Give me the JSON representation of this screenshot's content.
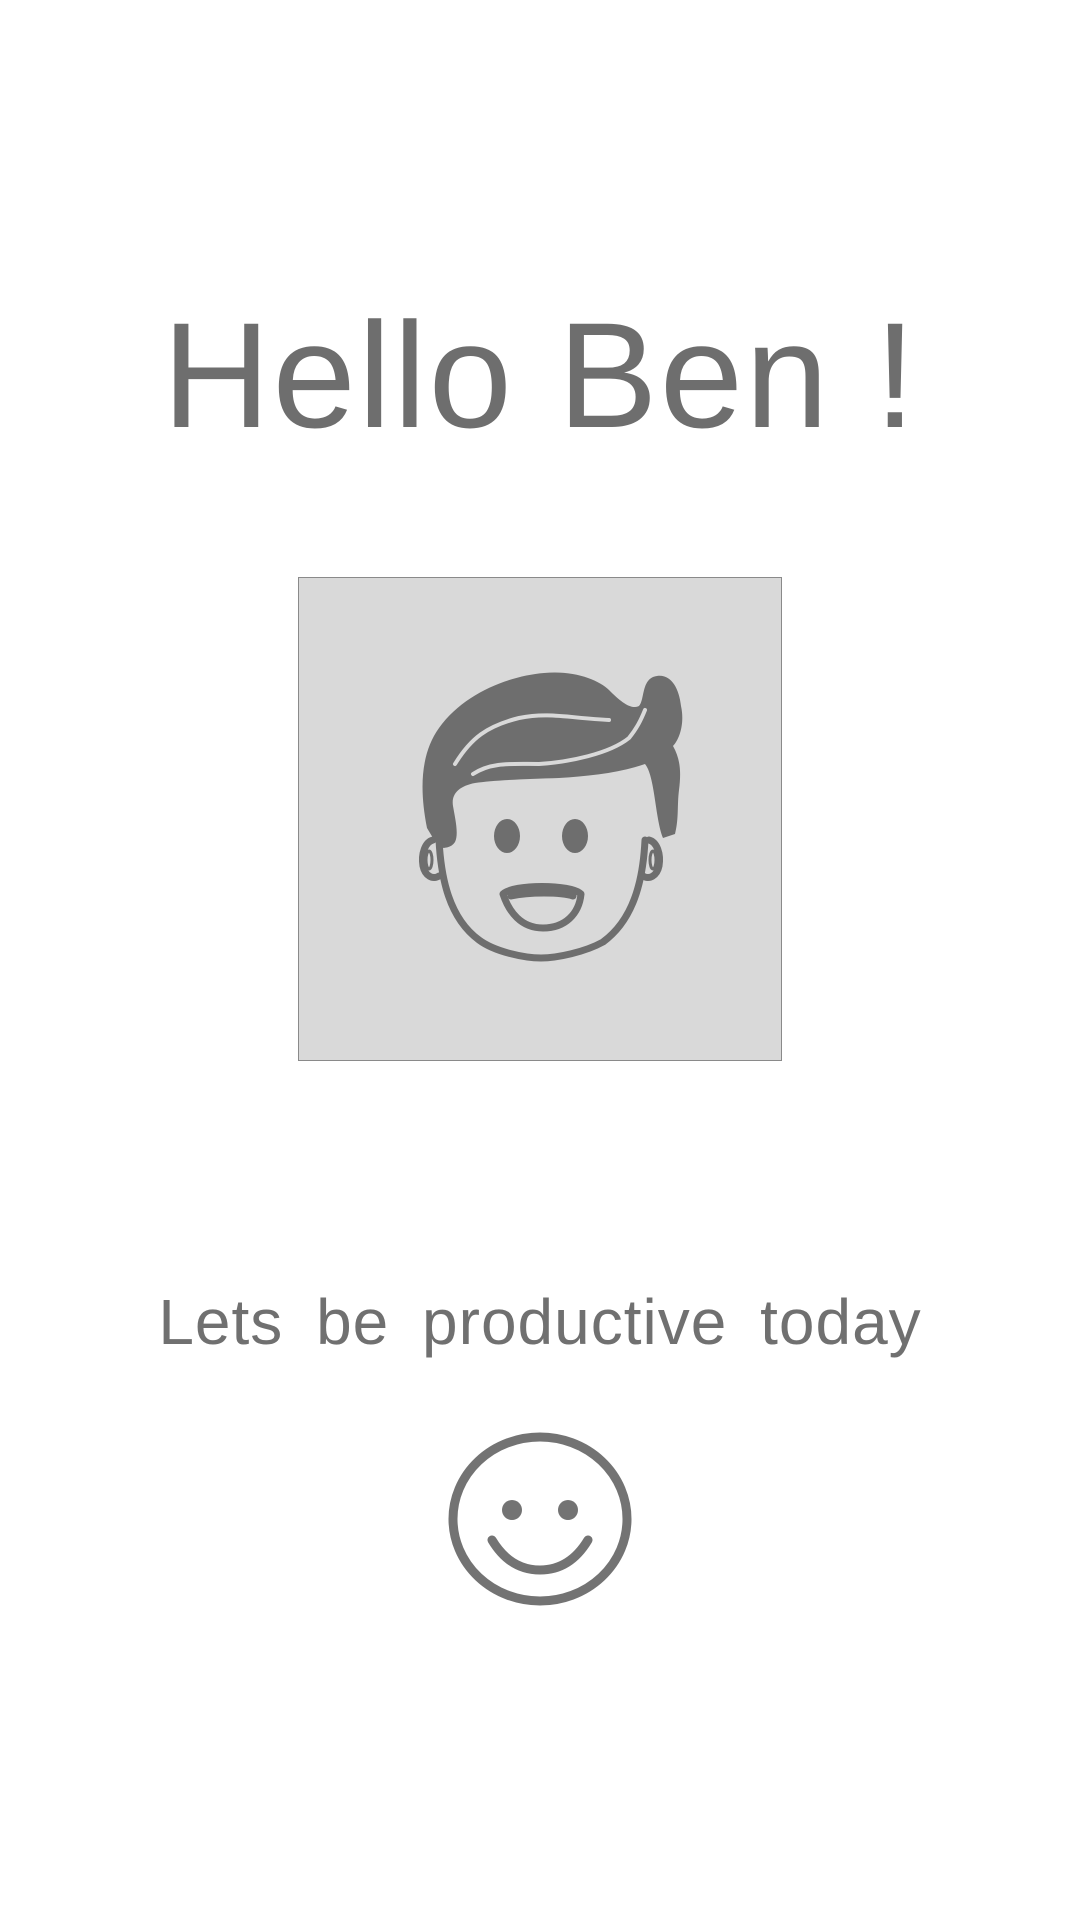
{
  "greeting": {
    "text": "Hello Ben !"
  },
  "avatar": {
    "icon": "male-avatar-face-icon",
    "background_color": "#d9d9d9",
    "icon_color": "#6e6e6e"
  },
  "tagline": {
    "text": "Lets  be  productive today"
  },
  "mood_icon": {
    "icon": "smiley-face-icon",
    "color": "#737373"
  }
}
